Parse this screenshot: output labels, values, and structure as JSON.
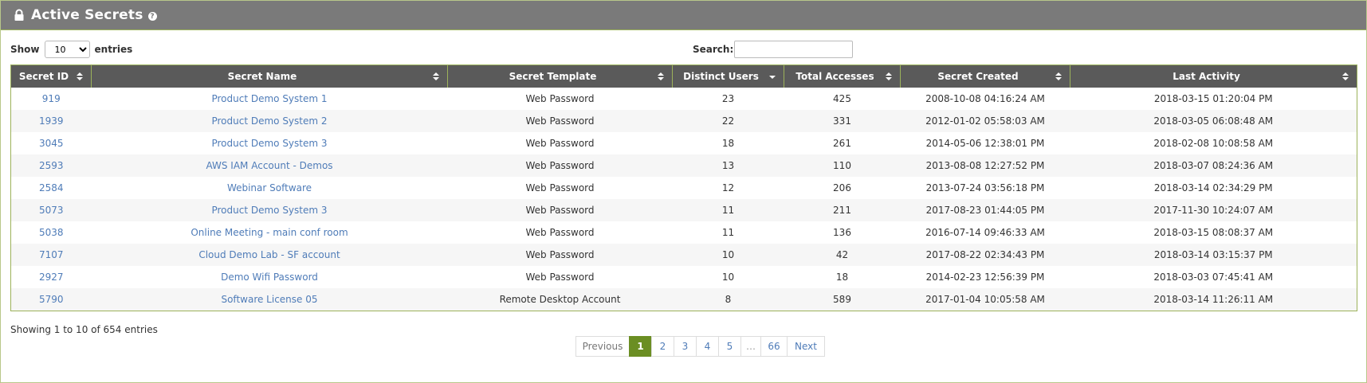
{
  "panel": {
    "title": "Active Secrets",
    "help_icon": "question-icon",
    "lock_icon": "lock-icon"
  },
  "controls": {
    "show_label": "Show",
    "entries_value": "10",
    "entries_options": [
      "10"
    ],
    "entries_label": "entries",
    "search_label": "Search:",
    "search_value": ""
  },
  "table": {
    "columns": [
      "Secret ID",
      "Secret Name",
      "Secret Template",
      "Distinct Users",
      "Total Accesses",
      "Secret Created",
      "Last Activity"
    ],
    "rows": [
      {
        "id": "919",
        "name": "Product Demo System 1",
        "template": "Web Password",
        "users": "23",
        "accesses": "425",
        "created": "2008-10-08 04:16:24 AM",
        "last": "2018-03-15 01:20:04 PM"
      },
      {
        "id": "1939",
        "name": "Product Demo System 2",
        "template": "Web Password",
        "users": "22",
        "accesses": "331",
        "created": "2012-01-02 05:58:03 AM",
        "last": "2018-03-05 06:08:48 AM"
      },
      {
        "id": "3045",
        "name": "Product Demo System 3",
        "template": "Web Password",
        "users": "18",
        "accesses": "261",
        "created": "2014-05-06 12:38:01 PM",
        "last": "2018-02-08 10:08:58 AM"
      },
      {
        "id": "2593",
        "name": "AWS IAM Account - Demos",
        "template": "Web Password",
        "users": "13",
        "accesses": "110",
        "created": "2013-08-08 12:27:52 PM",
        "last": "2018-03-07 08:24:36 AM"
      },
      {
        "id": "2584",
        "name": "Webinar Software",
        "template": "Web Password",
        "users": "12",
        "accesses": "206",
        "created": "2013-07-24 03:56:18 PM",
        "last": "2018-03-14 02:34:29 PM"
      },
      {
        "id": "5073",
        "name": "Product Demo System 3",
        "template": "Web Password",
        "users": "11",
        "accesses": "211",
        "created": "2017-08-23 01:44:05 PM",
        "last": "2017-11-30 10:24:07 AM"
      },
      {
        "id": "5038",
        "name": "Online Meeting - main conf room",
        "template": "Web Password",
        "users": "11",
        "accesses": "136",
        "created": "2016-07-14 09:46:33 AM",
        "last": "2018-03-15 08:08:37 AM"
      },
      {
        "id": "7107",
        "name": "Cloud Demo Lab - SF account",
        "template": "Web Password",
        "users": "10",
        "accesses": "42",
        "created": "2017-08-22 02:34:43 PM",
        "last": "2018-03-14 03:15:37 PM"
      },
      {
        "id": "2927",
        "name": "Demo Wifi Password",
        "template": "Web Password",
        "users": "10",
        "accesses": "18",
        "created": "2014-02-23 12:56:39 PM",
        "last": "2018-03-03 07:45:41 AM"
      },
      {
        "id": "5790",
        "name": "Software License 05",
        "template": "Remote Desktop Account",
        "users": "8",
        "accesses": "589",
        "created": "2017-01-04 10:05:58 AM",
        "last": "2018-03-14 11:26:11 AM"
      }
    ]
  },
  "footer": {
    "info": "Showing 1 to 10 of 654 entries"
  },
  "pagination": {
    "previous": "Previous",
    "pages": [
      "1",
      "2",
      "3",
      "4",
      "5"
    ],
    "ellipsis": "…",
    "last_page": "66",
    "next": "Next",
    "current": "1"
  },
  "colors": {
    "header_bg": "#7a7a7a",
    "table_head_bg": "#5a5a5a",
    "accent": "#6b8e23",
    "link": "#4f7cb8"
  }
}
